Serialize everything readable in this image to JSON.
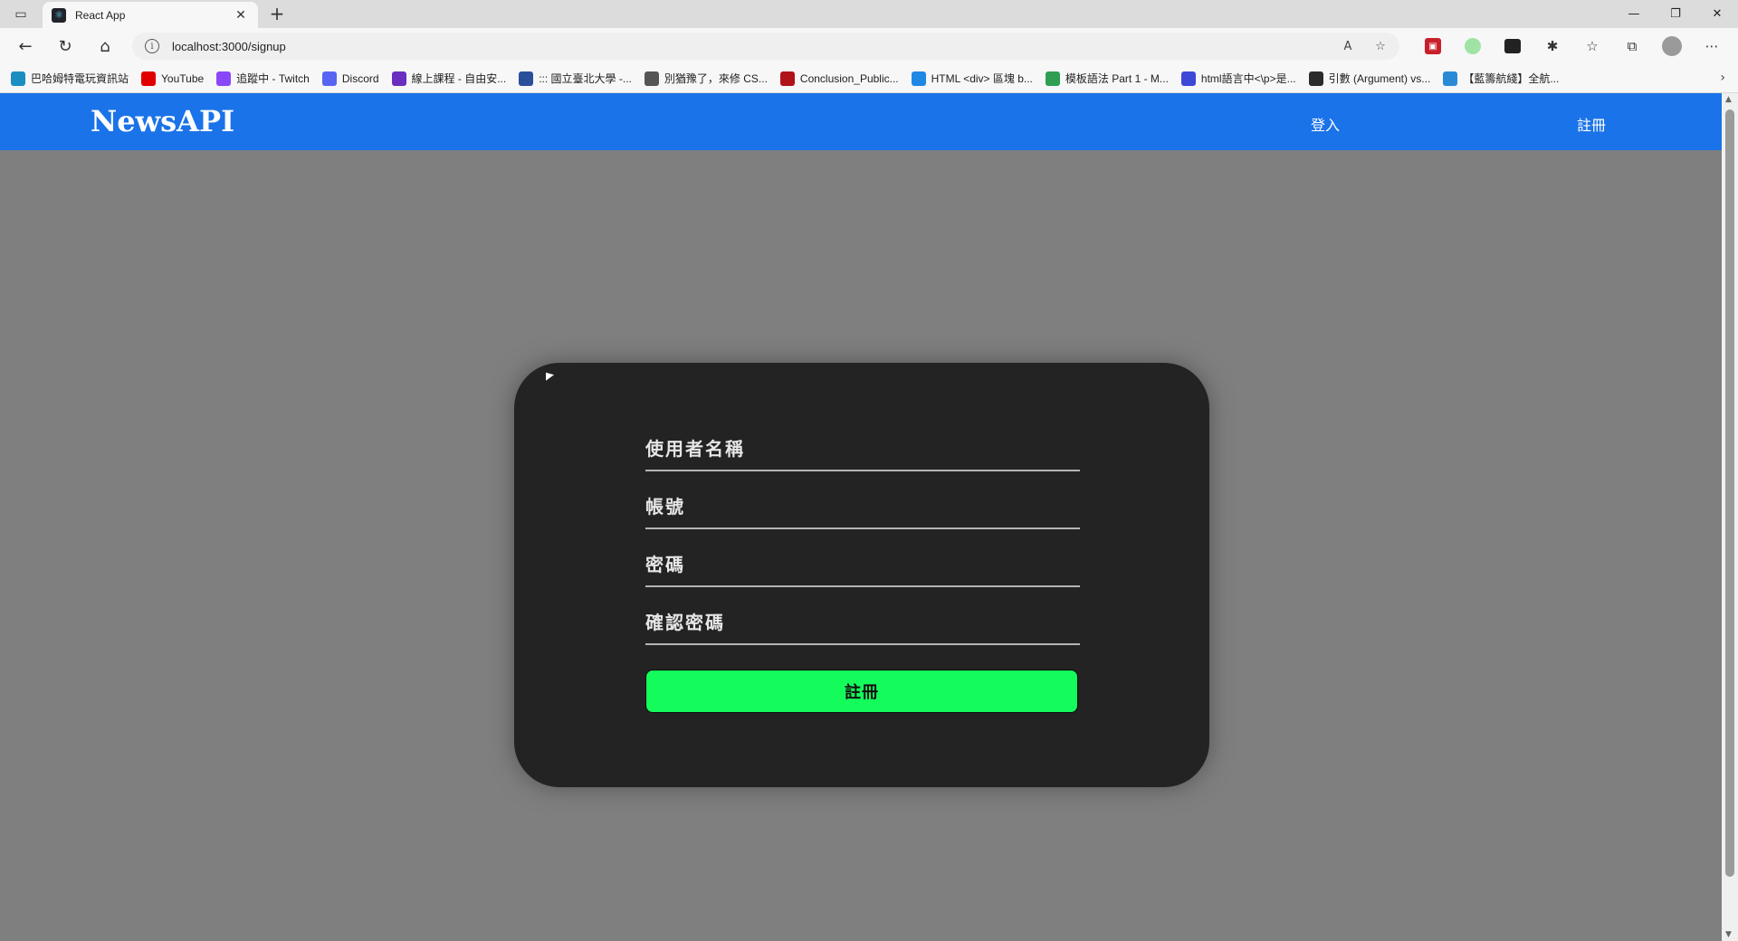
{
  "browser": {
    "tab_title": "React App",
    "url": "localhost:3000/signup",
    "bookmarks": [
      {
        "label": "巴哈姆特電玩資訊站",
        "icon": "bahamut-icon",
        "color": "#1b8ec1"
      },
      {
        "label": "YouTube",
        "icon": "youtube-icon",
        "color": "#e00000"
      },
      {
        "label": "追蹤中 - Twitch",
        "icon": "twitch-icon",
        "color": "#8a47f7"
      },
      {
        "label": "Discord",
        "icon": "discord-icon",
        "color": "#5865f2"
      },
      {
        "label": "線上課程 - 自由安...",
        "icon": "course-icon",
        "color": "#6a2fbf"
      },
      {
        "label": "::: 國立臺北大學 -...",
        "icon": "ntpu-icon",
        "color": "#2a4f9a"
      },
      {
        "label": "別猶豫了，來修 CS...",
        "icon": "tb-icon",
        "color": "#555555"
      },
      {
        "label": "Conclusion_Public...",
        "icon": "pdf-icon",
        "color": "#b0121a"
      },
      {
        "label": "HTML <div> 區塊 b...",
        "icon": "f-icon",
        "color": "#1e88e5"
      },
      {
        "label": "模板語法 Part 1 - M...",
        "icon": "vue-icon",
        "color": "#2f9e52"
      },
      {
        "label": "html語言中<\\p>是...",
        "icon": "baidu-icon",
        "color": "#3e48d6"
      },
      {
        "label": "引數 (Argument) vs...",
        "icon": "it-icon",
        "color": "#2b2b2b"
      },
      {
        "label": "【藍籌航綫】全航...",
        "icon": "tv-icon",
        "color": "#2a8ad6"
      }
    ]
  },
  "app": {
    "brand": "NewsAPI",
    "nav": {
      "login": "登入",
      "signup": "註冊"
    },
    "form": {
      "username_label": "使用者名稱",
      "account_label": "帳號",
      "password_label": "密碼",
      "confirm_label": "確認密碼",
      "submit_label": "註冊"
    }
  },
  "colors": {
    "navbar": "#1a73e8",
    "page_background": "#7f7f7f",
    "card": "#232323",
    "submit_button": "#14fb5c"
  }
}
